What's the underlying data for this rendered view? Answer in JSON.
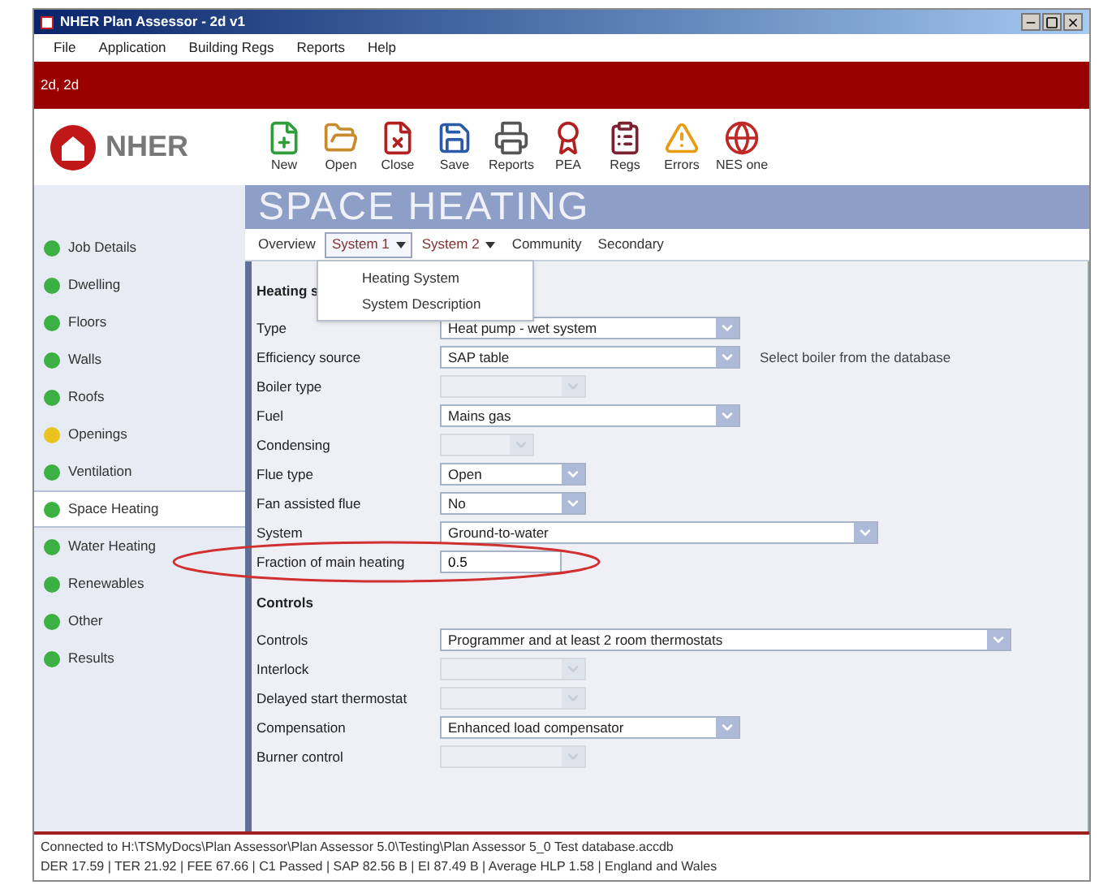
{
  "window": {
    "title": "NHER Plan Assessor - 2d v1"
  },
  "menu": [
    "File",
    "Application",
    "Building Regs",
    "Reports",
    "Help"
  ],
  "breadcrumb": "2d, 2d",
  "logo": {
    "text": "NHER"
  },
  "toolbar": [
    {
      "label": "New",
      "kind": "new"
    },
    {
      "label": "Open",
      "kind": "open"
    },
    {
      "label": "Close",
      "kind": "close"
    },
    {
      "label": "Save",
      "kind": "save"
    },
    {
      "label": "Reports",
      "kind": "reports"
    },
    {
      "label": "PEA",
      "kind": "pea"
    },
    {
      "label": "Regs",
      "kind": "regs"
    },
    {
      "label": "Errors",
      "kind": "errors"
    },
    {
      "label": "NES one",
      "kind": "globe"
    }
  ],
  "page_title": "SPACE HEATING",
  "sidebar": {
    "items": [
      {
        "label": "Job Details",
        "color": "#3cb043",
        "selected": false
      },
      {
        "label": "Dwelling",
        "color": "#3cb043",
        "selected": false
      },
      {
        "label": "Floors",
        "color": "#3cb043",
        "selected": false
      },
      {
        "label": "Walls",
        "color": "#3cb043",
        "selected": false
      },
      {
        "label": "Roofs",
        "color": "#3cb043",
        "selected": false
      },
      {
        "label": "Openings",
        "color": "#e8c31e",
        "selected": false
      },
      {
        "label": "Ventilation",
        "color": "#3cb043",
        "selected": false
      },
      {
        "label": "Space Heating",
        "color": "#3cb043",
        "selected": true
      },
      {
        "label": "Water Heating",
        "color": "#3cb043",
        "selected": false
      },
      {
        "label": "Renewables",
        "color": "#3cb043",
        "selected": false
      },
      {
        "label": "Other",
        "color": "#3cb043",
        "selected": false
      },
      {
        "label": "Results",
        "color": "#3cb043",
        "selected": false
      }
    ]
  },
  "tabs": [
    {
      "label": "Overview",
      "selected": false,
      "has_menu": false
    },
    {
      "label": "System 1",
      "selected": true,
      "has_menu": true
    },
    {
      "label": "System 2",
      "selected": false,
      "has_menu": true
    },
    {
      "label": "Community",
      "selected": false,
      "has_menu": false
    },
    {
      "label": "Secondary",
      "selected": false,
      "has_menu": false
    }
  ],
  "tab_menu": {
    "items": [
      "Heating System",
      "System Description"
    ]
  },
  "sections": [
    {
      "heading": "Heating s",
      "fields": [
        {
          "label": "Type",
          "kind": "select",
          "value": "Heat pump - wet system",
          "disabled": false
        },
        {
          "label": "Efficiency source",
          "kind": "select",
          "value": "SAP table",
          "disabled": false,
          "note": "Select boiler from the database"
        },
        {
          "label": "Boiler type",
          "kind": "select",
          "disabled": true
        },
        {
          "label": "Fuel",
          "kind": "select",
          "value": "Mains gas",
          "disabled": false
        },
        {
          "label": "Condensing",
          "kind": "select",
          "disabled": true
        },
        {
          "label": "Flue type",
          "kind": "select",
          "value": "Open",
          "disabled": false
        },
        {
          "label": "Fan assisted flue",
          "kind": "select",
          "value": "No",
          "disabled": false
        },
        {
          "label": "System",
          "kind": "select",
          "value": "Ground-to-water",
          "disabled": false
        },
        {
          "label": "Fraction of main heating",
          "kind": "text",
          "value": "0.5",
          "disabled": false,
          "highlighted": true
        }
      ]
    },
    {
      "heading": "Controls",
      "fields": [
        {
          "label": "Controls",
          "kind": "select",
          "value": "Programmer and at least 2 room thermostats",
          "disabled": false
        },
        {
          "label": "Interlock",
          "kind": "select",
          "disabled": true
        },
        {
          "label": "Delayed start thermostat",
          "kind": "select",
          "disabled": true
        },
        {
          "label": "Compensation",
          "kind": "select",
          "value": "Enhanced load compensator",
          "disabled": false
        },
        {
          "label": "Burner control",
          "kind": "select",
          "disabled": true
        }
      ]
    }
  ],
  "status_bar": {
    "lines": [
      "Connected to H:\\TSMyDocs\\Plan Assessor\\Plan Assessor 5.0\\Testing\\Plan Assessor 5_0 Test database.accdb",
      "DER 17.59 | TER 21.92 | FEE 67.66 | C1 Passed | SAP 82.56 B | EI 87.49 B | Average HLP 1.58 | England and Wales"
    ]
  }
}
